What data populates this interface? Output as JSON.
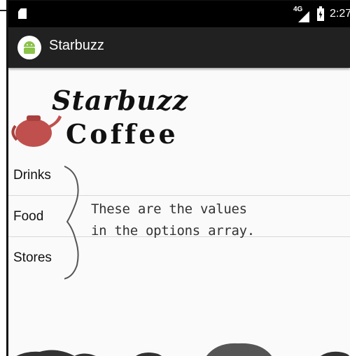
{
  "status_bar": {
    "network": "4G",
    "time": "2:27",
    "icons": [
      "sd-card-icon",
      "signal-icon",
      "battery-charging-icon"
    ]
  },
  "app_bar": {
    "title": "Starbuzz",
    "icon": "android-icon"
  },
  "logo": {
    "line1": "Starbuzz",
    "line2": "Coffee",
    "icon": "teapot-icon"
  },
  "options": [
    "Drinks",
    "Food",
    "Stores"
  ],
  "annotation": {
    "line1": "These are the values",
    "line2": "in the options array."
  },
  "colors": {
    "app_bar": "#212121",
    "status_bar": "#000000",
    "teapot": "#c0504d",
    "background": "#fafafa"
  }
}
